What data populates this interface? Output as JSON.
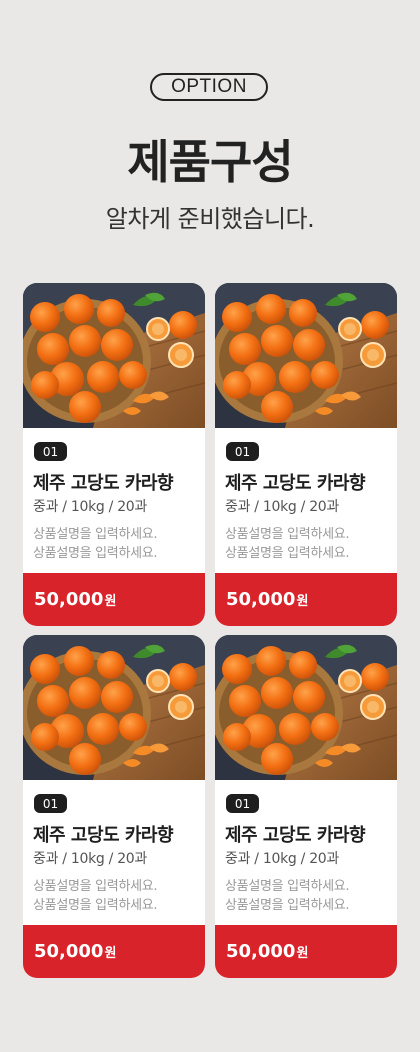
{
  "header": {
    "pill_label": "OPTION",
    "title": "제품구성",
    "subtitle": "알차게 준비했습니다."
  },
  "products": [
    {
      "badge": "01",
      "name": "제주 고당도 카라향",
      "spec": "중과 / 10kg / 20과",
      "desc_line1": "상품설명을 입력하세요.",
      "desc_line2": "상품설명을 입력하세요.",
      "price": "50,000",
      "currency": "원"
    },
    {
      "badge": "01",
      "name": "제주 고당도 카라향",
      "spec": "중과 / 10kg / 20과",
      "desc_line1": "상품설명을 입력하세요.",
      "desc_line2": "상품설명을 입력하세요.",
      "price": "50,000",
      "currency": "원"
    },
    {
      "badge": "01",
      "name": "제주 고당도 카라향",
      "spec": "중과 / 10kg / 20과",
      "desc_line1": "상품설명을 입력하세요.",
      "desc_line2": "상품설명을 입력하세요.",
      "price": "50,000",
      "currency": "원"
    },
    {
      "badge": "01",
      "name": "제주 고당도 카라향",
      "spec": "중과 / 10kg / 20과",
      "desc_line1": "상품설명을 입력하세요.",
      "desc_line2": "상품설명을 입력하세요.",
      "price": "50,000",
      "currency": "원"
    }
  ],
  "colors": {
    "background": "#e9e8e7",
    "accent_red": "#d9232a",
    "badge_dark": "#1e1e1e"
  },
  "icons": [
    "mandarin-photo"
  ]
}
